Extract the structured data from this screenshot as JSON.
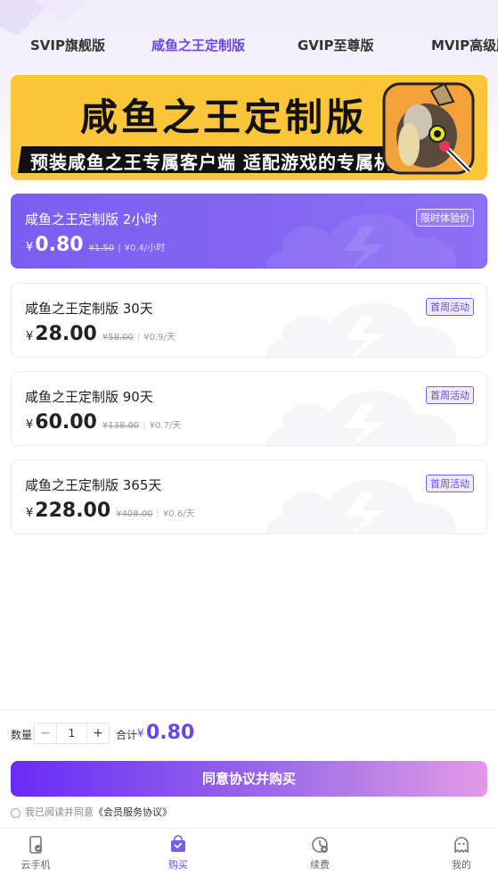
{
  "tabs": [
    {
      "label": "SVIP旗舰版",
      "active": false
    },
    {
      "label": "咸鱼之王定制版",
      "active": true
    },
    {
      "label": "GVIP至尊版",
      "active": false
    },
    {
      "label": "MVIP高级版",
      "active": false
    }
  ],
  "banner": {
    "title": "咸鱼之王定制版",
    "subtitle": "预装咸鱼之王专属客户端 适配游戏的专属机型"
  },
  "plans": [
    {
      "name": "咸鱼之王定制版 2小时",
      "badge": "限时体验价",
      "currency": "¥",
      "price": "0.80",
      "original": "¥1.50",
      "unit_price": "¥0.4/小时",
      "selected": true
    },
    {
      "name": "咸鱼之王定制版 30天",
      "badge": "首周活动",
      "currency": "¥",
      "price": "28.00",
      "original": "¥58.00",
      "unit_price": "¥0.9/天",
      "selected": false
    },
    {
      "name": "咸鱼之王定制版 90天",
      "badge": "首周活动",
      "currency": "¥",
      "price": "60.00",
      "original": "¥138.00",
      "unit_price": "¥0.7/天",
      "selected": false
    },
    {
      "name": "咸鱼之王定制版 365天",
      "badge": "首周活动",
      "currency": "¥",
      "price": "228.00",
      "original": "¥408.00",
      "unit_price": "¥0.6/天",
      "selected": false
    }
  ],
  "purchase": {
    "qty_label": "数量",
    "minus": "−",
    "quantity": "1",
    "plus": "+",
    "total_label": "合计",
    "total_currency": "¥",
    "total_value": "0.80",
    "buy_label": "同意协议并购买",
    "agree_text": "我已阅读并同意",
    "agree_link": "《会员服务协议》"
  },
  "nav": [
    {
      "label": "云手机",
      "icon": "phone-icon",
      "active": false
    },
    {
      "label": "购买",
      "icon": "shopping-bag-icon",
      "active": true
    },
    {
      "label": "续费",
      "icon": "renew-clock-icon",
      "active": false
    },
    {
      "label": "我的",
      "icon": "profile-ghost-icon",
      "active": false
    }
  ],
  "colors": {
    "accent": "#6a46e8",
    "banner_yellow": "#fbc63a",
    "selected_card": "#7a5ef0"
  }
}
